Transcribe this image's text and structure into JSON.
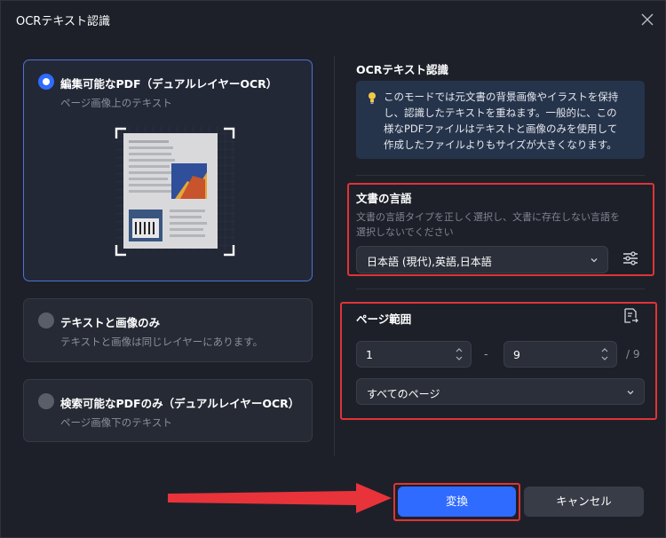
{
  "window": {
    "title": "OCRテキスト認識"
  },
  "modes": [
    {
      "title": "編集可能なPDF（デュアルレイヤーOCR）",
      "subtitle": "ページ画像上のテキスト",
      "selected": true
    },
    {
      "title": "テキストと画像のみ",
      "subtitle": "テキストと画像は同じレイヤーにあります。",
      "selected": false
    },
    {
      "title": "検索可能なPDFのみ（デュアルレイヤーOCR）",
      "subtitle": "ページ画像下のテキスト",
      "selected": false
    }
  ],
  "info": {
    "title": "OCRテキスト認識",
    "icon": "lightbulb-icon",
    "lines": [
      "このモードでは元文書の背景画像やイラストを保持",
      "し、認識したテキストを重ねます。一般的に、この",
      "様なPDFファイルはテキストと画像のみを使用して",
      "作成したファイルよりもサイズが大きくなります。"
    ]
  },
  "language": {
    "title": "文書の言語",
    "desc_lines": [
      "文書の言語タイプを正しく選択し、文書に存在しない言語を",
      "選択しないでください"
    ],
    "selected": "日本語 (現代),英語,日本語"
  },
  "page_range": {
    "title": "ページ範囲",
    "from": "1",
    "separator": "-",
    "to": "9",
    "total": "/ 9",
    "scope": "すべてのページ"
  },
  "buttons": {
    "convert": "変換",
    "cancel": "キャンセル"
  },
  "colors": {
    "accent": "#2f6bff",
    "highlight": "#e03336",
    "background": "#1d2029"
  }
}
